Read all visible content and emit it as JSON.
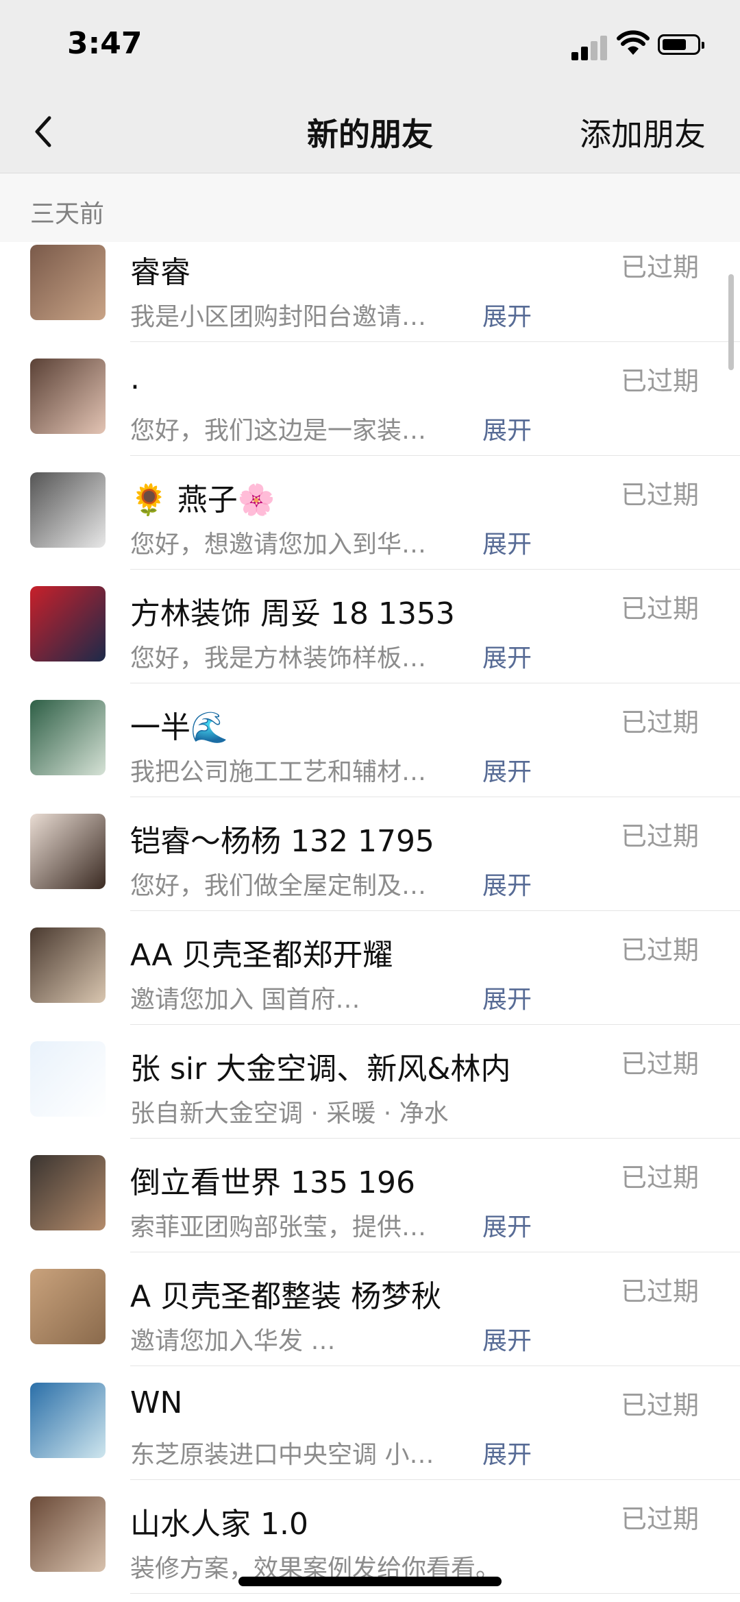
{
  "status_bar": {
    "time": "3:47"
  },
  "navbar": {
    "title": "新的朋友",
    "action": "添加朋友"
  },
  "section": {
    "label": "三天前"
  },
  "rows": [
    {
      "name": "睿睿",
      "message": "我是小区团购封阳台邀请…",
      "expand": "展开",
      "status": "已过期",
      "avatar_colors": [
        "#7a5a4a",
        "#c9a487"
      ]
    },
    {
      "name": ".",
      "message": "您好，我们这边是一家装…",
      "expand": "展开",
      "status": "已过期",
      "avatar_colors": [
        "#5a4136",
        "#e3c4b4"
      ]
    },
    {
      "name": "🌻 燕子🌸",
      "message": "您好，想邀请您加入到华…",
      "expand": "展开",
      "status": "已过期",
      "avatar_colors": [
        "#555555",
        "#e8e8e8"
      ]
    },
    {
      "name": "方林装饰 周妥 18 1353",
      "message": "您好，我是方林装饰样板…",
      "expand": "展开",
      "status": "已过期",
      "avatar_colors": [
        "#c8202a",
        "#1c2a4a"
      ]
    },
    {
      "name": "一半🌊",
      "message": "我把公司施工工艺和辅材…",
      "expand": "展开",
      "status": "已过期",
      "avatar_colors": [
        "#2e5f46",
        "#d6e2d6"
      ]
    },
    {
      "name": "铠睿～杨杨 132 1795",
      "message": "您好，我们做全屋定制及…",
      "expand": "展开",
      "status": "已过期",
      "avatar_colors": [
        "#e9dcd3",
        "#3a2a22"
      ]
    },
    {
      "name": "AA 贝壳圣都郑开耀",
      "message": "邀请您加入 国首府…",
      "expand": "展开",
      "status": "已过期",
      "avatar_colors": [
        "#4a3a30",
        "#d9c6b0"
      ]
    },
    {
      "name": "张 sir 大金空调、新风&林内",
      "message": "张自新大金空调 · 采暖 · 净水",
      "expand": "",
      "status": "已过期",
      "avatar_colors": [
        "#e9f2fb",
        "#ffffff"
      ]
    },
    {
      "name": "倒立看世界 135 196",
      "message": "索菲亚团购部张莹，提供…",
      "expand": "展开",
      "status": "已过期",
      "avatar_colors": [
        "#3a3430",
        "#b48c6c"
      ]
    },
    {
      "name": "A 贝壳圣都整装 杨梦秋",
      "message": "邀请您加入华发 …",
      "expand": "展开",
      "status": "已过期",
      "avatar_colors": [
        "#c9a27c",
        "#8a6a4c"
      ]
    },
    {
      "name": "WN",
      "message": "东芝原装进口中央空调 小…",
      "expand": "展开",
      "status": "已过期",
      "avatar_colors": [
        "#2b6fa8",
        "#cfe6ee"
      ]
    },
    {
      "name": "山水人家 1.0",
      "message": "装修方案，效果案例发给你看看。",
      "expand": "",
      "status": "已过期",
      "avatar_colors": [
        "#6a4a38",
        "#d8c2ae"
      ]
    }
  ]
}
